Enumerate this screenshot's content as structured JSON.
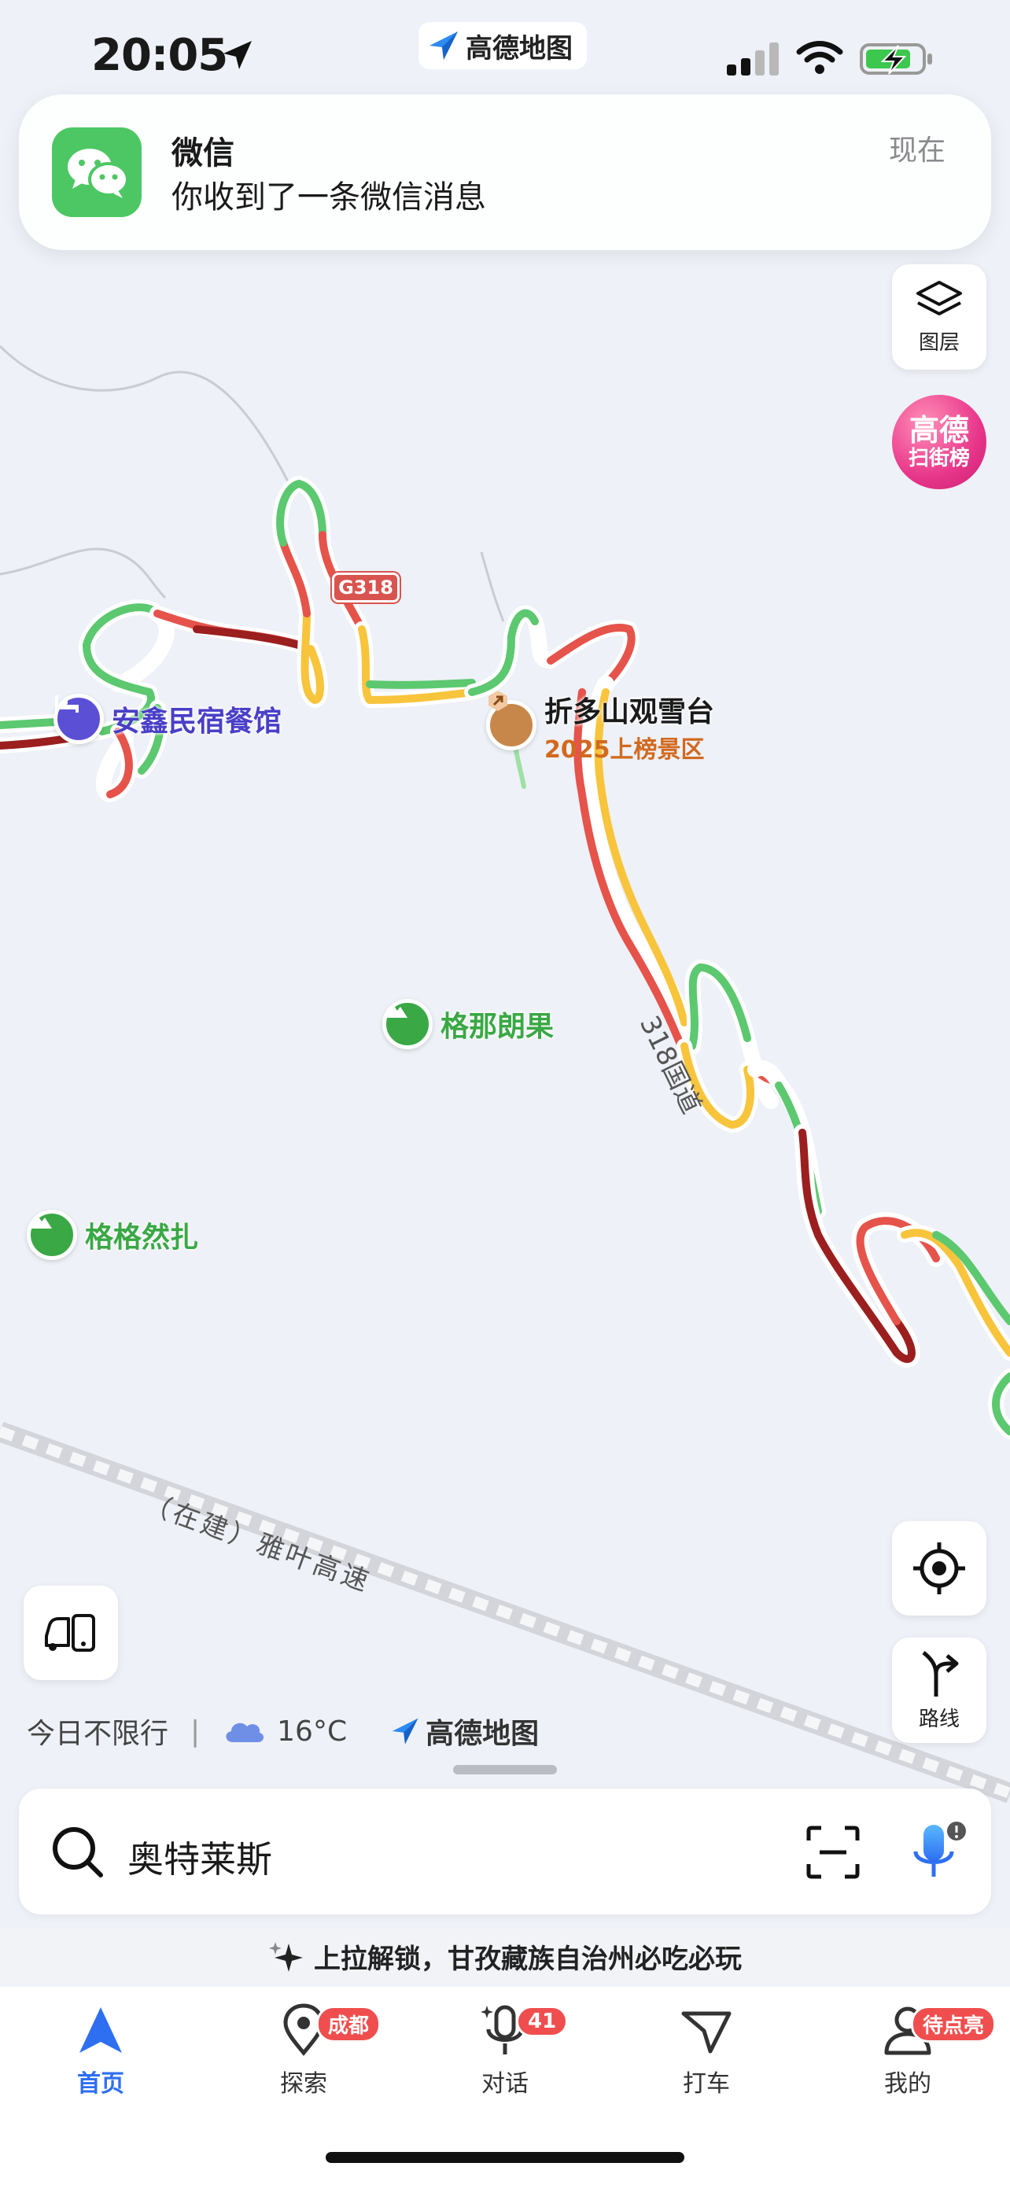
{
  "status_bar": {
    "time": "20:05",
    "app_pill": "高德地图",
    "icons": [
      "location-arrow-icon",
      "cellular-signal-icon",
      "wifi-icon",
      "battery-charging-icon"
    ]
  },
  "notification": {
    "app": "微信",
    "message": "你收到了一条微信消息",
    "time": "现在",
    "icon": "wechat-icon"
  },
  "map_controls": {
    "layers_label": "图层",
    "rank_line1": "高德",
    "rank_line2": "扫街榜",
    "route_label": "路线"
  },
  "map": {
    "road_shield": "G318",
    "road_name": "318国道",
    "highway": "（在建）雅叶高速",
    "pois": [
      {
        "name": "安鑫民宿餐馆",
        "icon": "hotel-bed-icon",
        "color": "#5b4fd6"
      },
      {
        "name": "折多山观雪台",
        "sub": "2025上榜景区",
        "icon": "scenic-spot-icon",
        "color": "#c8874a"
      },
      {
        "name": "格那朗果",
        "icon": "mountain-icon",
        "color": "#3aa845"
      },
      {
        "name": "格格然扎",
        "icon": "mountain-icon",
        "color": "#3aa845"
      }
    ],
    "traffic_colors": {
      "smooth": "#5cc86f",
      "slow": "#f7c43c",
      "jam": "#e5534b",
      "severe": "#9b1f1f"
    }
  },
  "info_bar": {
    "restriction": "今日不限行",
    "temperature": "16°C",
    "brand": "高德地图"
  },
  "search": {
    "value": "奥特莱斯"
  },
  "promo": "上拉解锁，甘孜藏族自治州必吃必玩",
  "tabs": [
    {
      "label": "首页",
      "active": true,
      "icon": "navigation-arrow-icon"
    },
    {
      "label": "探索",
      "badge": "成都",
      "icon": "location-pin-icon"
    },
    {
      "label": "对话",
      "badge": "41",
      "icon": "microphone-icon"
    },
    {
      "label": "打车",
      "icon": "taxi-arrow-icon"
    },
    {
      "label": "我的",
      "badge": "待点亮",
      "icon": "user-icon"
    }
  ]
}
